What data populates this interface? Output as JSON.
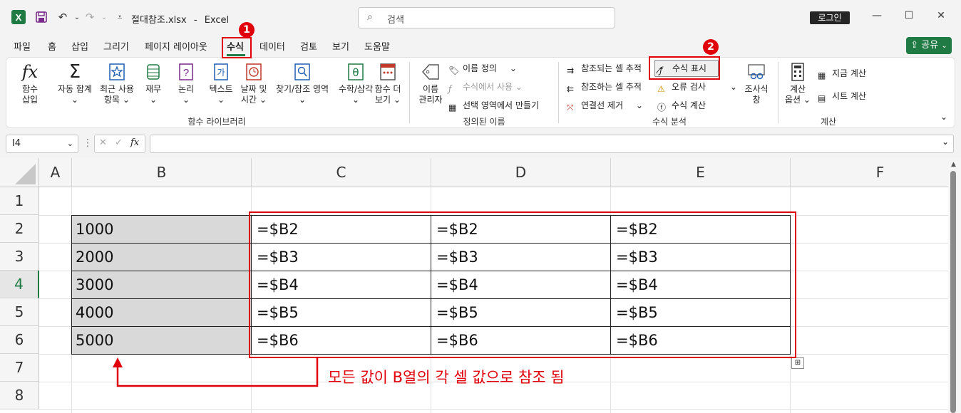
{
  "titlebar": {
    "filename": "절대참조.xlsx",
    "separator": "-",
    "app": "Excel",
    "search_placeholder": "검색",
    "login_label": "로그인"
  },
  "tabs": [
    "파일",
    "홈",
    "삽입",
    "그리기",
    "페이지 레이아웃",
    "수식",
    "데이터",
    "검토",
    "보기",
    "도움말"
  ],
  "active_tab": "수식",
  "share_label": "공유",
  "ribbon": {
    "library": {
      "insert_function": [
        "함수",
        "삽입"
      ],
      "autosum": [
        "자동 합계"
      ],
      "recent": [
        "최근 사용",
        "항목"
      ],
      "financial": [
        "재무"
      ],
      "logical": [
        "논리"
      ],
      "text": [
        "텍스트"
      ],
      "datetime": [
        "날짜 및",
        "시간"
      ],
      "lookup": [
        "찾기/참조 영역"
      ],
      "math": [
        "수학/삼각"
      ],
      "more": [
        "함수 더",
        "보기"
      ],
      "group_label": "함수 라이브러리"
    },
    "names": {
      "name_manager": [
        "이름",
        "관리자"
      ],
      "define_name": "이름 정의",
      "use_in_formula": "수식에서 사용",
      "create_from_selection": "선택 영역에서 만들기",
      "group_label": "정의된 이름"
    },
    "audit": {
      "trace_precedents": "참조되는 셀 추적",
      "trace_dependents": "참조하는 셀 추적",
      "remove_arrows": "연결선 제거",
      "show_formulas": "수식 표시",
      "error_checking": "오류 검사",
      "evaluate_formula": "수식 계산",
      "watch_window": [
        "조사식",
        "창"
      ],
      "group_label": "수식 분석"
    },
    "calculation": {
      "options": [
        "계산",
        "옵션"
      ],
      "calc_now": "지금 계산",
      "calc_sheet": "시트 계산",
      "group_label": "계산"
    }
  },
  "formula_bar": {
    "name_box": "I4",
    "fx": "fx",
    "formula": ""
  },
  "sheet": {
    "columns": [
      "A",
      "B",
      "C",
      "D",
      "E",
      "F"
    ],
    "rows": [
      "1",
      "2",
      "3",
      "4",
      "5",
      "6",
      "7",
      "8"
    ],
    "active_row": "4",
    "b_values": [
      "1000",
      "2000",
      "3000",
      "4000",
      "5000"
    ],
    "formulas": [
      [
        "=$B2",
        "=$B2",
        "=$B2"
      ],
      [
        "=$B3",
        "=$B3",
        "=$B3"
      ],
      [
        "=$B4",
        "=$B4",
        "=$B4"
      ],
      [
        "=$B5",
        "=$B5",
        "=$B5"
      ],
      [
        "=$B6",
        "=$B6",
        "=$B6"
      ]
    ]
  },
  "annotations": {
    "badge1": "1",
    "badge2": "2",
    "note": "모든 값이 B열의 각 셀 값으로 참조 됨",
    "red_color": "#e0000b"
  }
}
